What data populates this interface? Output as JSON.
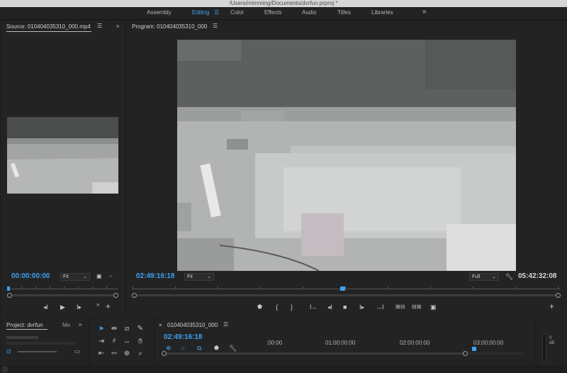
{
  "window": {
    "title": "/Users/mimming/Documents/dvrfun.prproj *"
  },
  "workspaces": {
    "items": [
      "Assembly",
      "Editing",
      "Color",
      "Effects",
      "Audio",
      "Titles",
      "Libraries"
    ],
    "active": "Editing"
  },
  "source": {
    "tab": "Source: 010404035310_000.mp4",
    "timecode": "00:00:00:00",
    "fit": "Fit"
  },
  "program": {
    "tab": "Program: 010404035310_000",
    "timecode": "02:49:16:18",
    "fit": "Fit",
    "resolution": "Full",
    "duration": "05:42:32:08"
  },
  "project": {
    "tab": "Project: dvrfun",
    "tab2": "Me"
  },
  "timeline": {
    "tab": "010404035310_000",
    "timecode": "02:49:16:18",
    "ruler_labels": [
      ":00:00",
      "01:00:00:00",
      "02:00:00:00",
      "03:00:00:00"
    ]
  },
  "meter": {
    "scale": [
      "0",
      "dB"
    ]
  },
  "colors": {
    "accent": "#3ea1f2",
    "panel": "#232323",
    "background": "#1e1e1e"
  },
  "icons": {
    "menu": "hamburger-icon",
    "more": "double-chevron-right-icon",
    "tools": [
      "selection",
      "track-select",
      "ripple-edit",
      "razor",
      "slip",
      "pen",
      "hand",
      "zoom"
    ]
  }
}
